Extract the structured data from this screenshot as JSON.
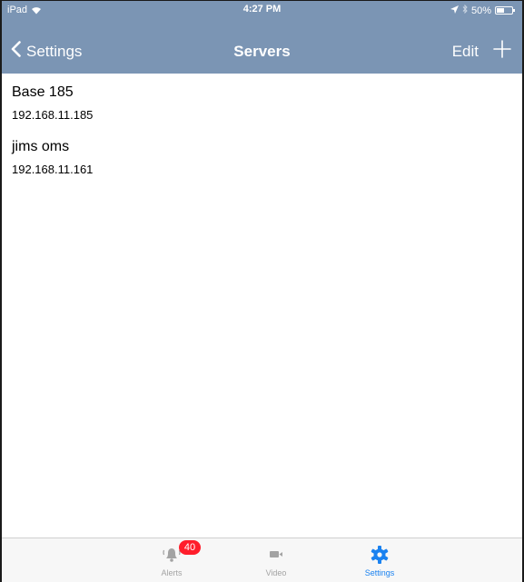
{
  "status_bar": {
    "device": "iPad",
    "time": "4:27 PM",
    "battery": "50%",
    "battery_level": 0.5
  },
  "nav": {
    "back_label": "Settings",
    "title": "Servers",
    "edit_label": "Edit"
  },
  "servers": [
    {
      "name": "Base 185",
      "address": "192.168.11.185"
    },
    {
      "name": "jims oms",
      "address": "192.168.11.161"
    }
  ],
  "tabs": {
    "alerts": {
      "label": "Alerts",
      "icon": "bell-icon",
      "badge": "40"
    },
    "video": {
      "label": "Video",
      "icon": "video-camera-icon"
    },
    "settings": {
      "label": "Settings",
      "icon": "gear-icon"
    }
  },
  "colors": {
    "nav_background": "#7b95b4",
    "active_tab": "#1a82f0",
    "inactive_tab": "#a3a3a3",
    "badge": "#ff1d2b"
  }
}
